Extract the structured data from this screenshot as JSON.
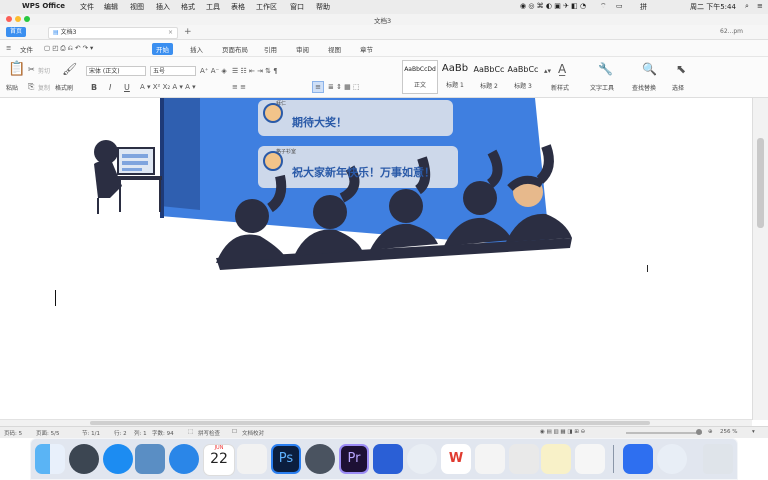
{
  "menubar": {
    "app_name": "WPS Office",
    "items": [
      "文件",
      "编辑",
      "视图",
      "插入",
      "格式",
      "工具",
      "表格",
      "工作区",
      "窗口",
      "帮助"
    ],
    "clock": "周二 下午5:44"
  },
  "window": {
    "title": "文档3"
  },
  "tabs": {
    "home": "首页",
    "doc": "文档3",
    "new": "+",
    "user": "62...pm"
  },
  "ribbon_tabs": [
    "文件",
    "开始",
    "插入",
    "页面布局",
    "引用",
    "审阅",
    "视图",
    "章节"
  ],
  "ribbon_active": "开始",
  "ribbon": {
    "paste": "粘贴",
    "cut": "剪切",
    "copy": "复制",
    "format_painter": "格式刷",
    "font": "宋体 (正文)",
    "size": "五号",
    "styles": [
      {
        "preview": "AaBbCcDd",
        "label": "正文"
      },
      {
        "preview": "AaBb",
        "label": "标题 1"
      },
      {
        "preview": "AaBbCc",
        "label": "标题 2"
      },
      {
        "preview": "AaBbCc",
        "label": "标题 3"
      }
    ],
    "new_style": "新样式",
    "text_tools": "文字工具",
    "find_replace": "查找替换",
    "select": "选择"
  },
  "illustration": {
    "comment1_name": "拜仁",
    "comment1_text": "期待大奖！",
    "comment2_name": "格子衫室",
    "comment2_text": "祝大家新年快乐！万事如意！"
  },
  "status": {
    "page_num": "页码: 5",
    "pages": "页面: 5/5",
    "section": "节: 1/1",
    "row": "行: 2",
    "col": "列: 1",
    "words": "字数: 94",
    "spell": "拼写检查",
    "doc_check": "文档校对",
    "zoom": "256 %"
  },
  "dock": {
    "calendar_day": "22",
    "calendar_month": "JUN"
  }
}
